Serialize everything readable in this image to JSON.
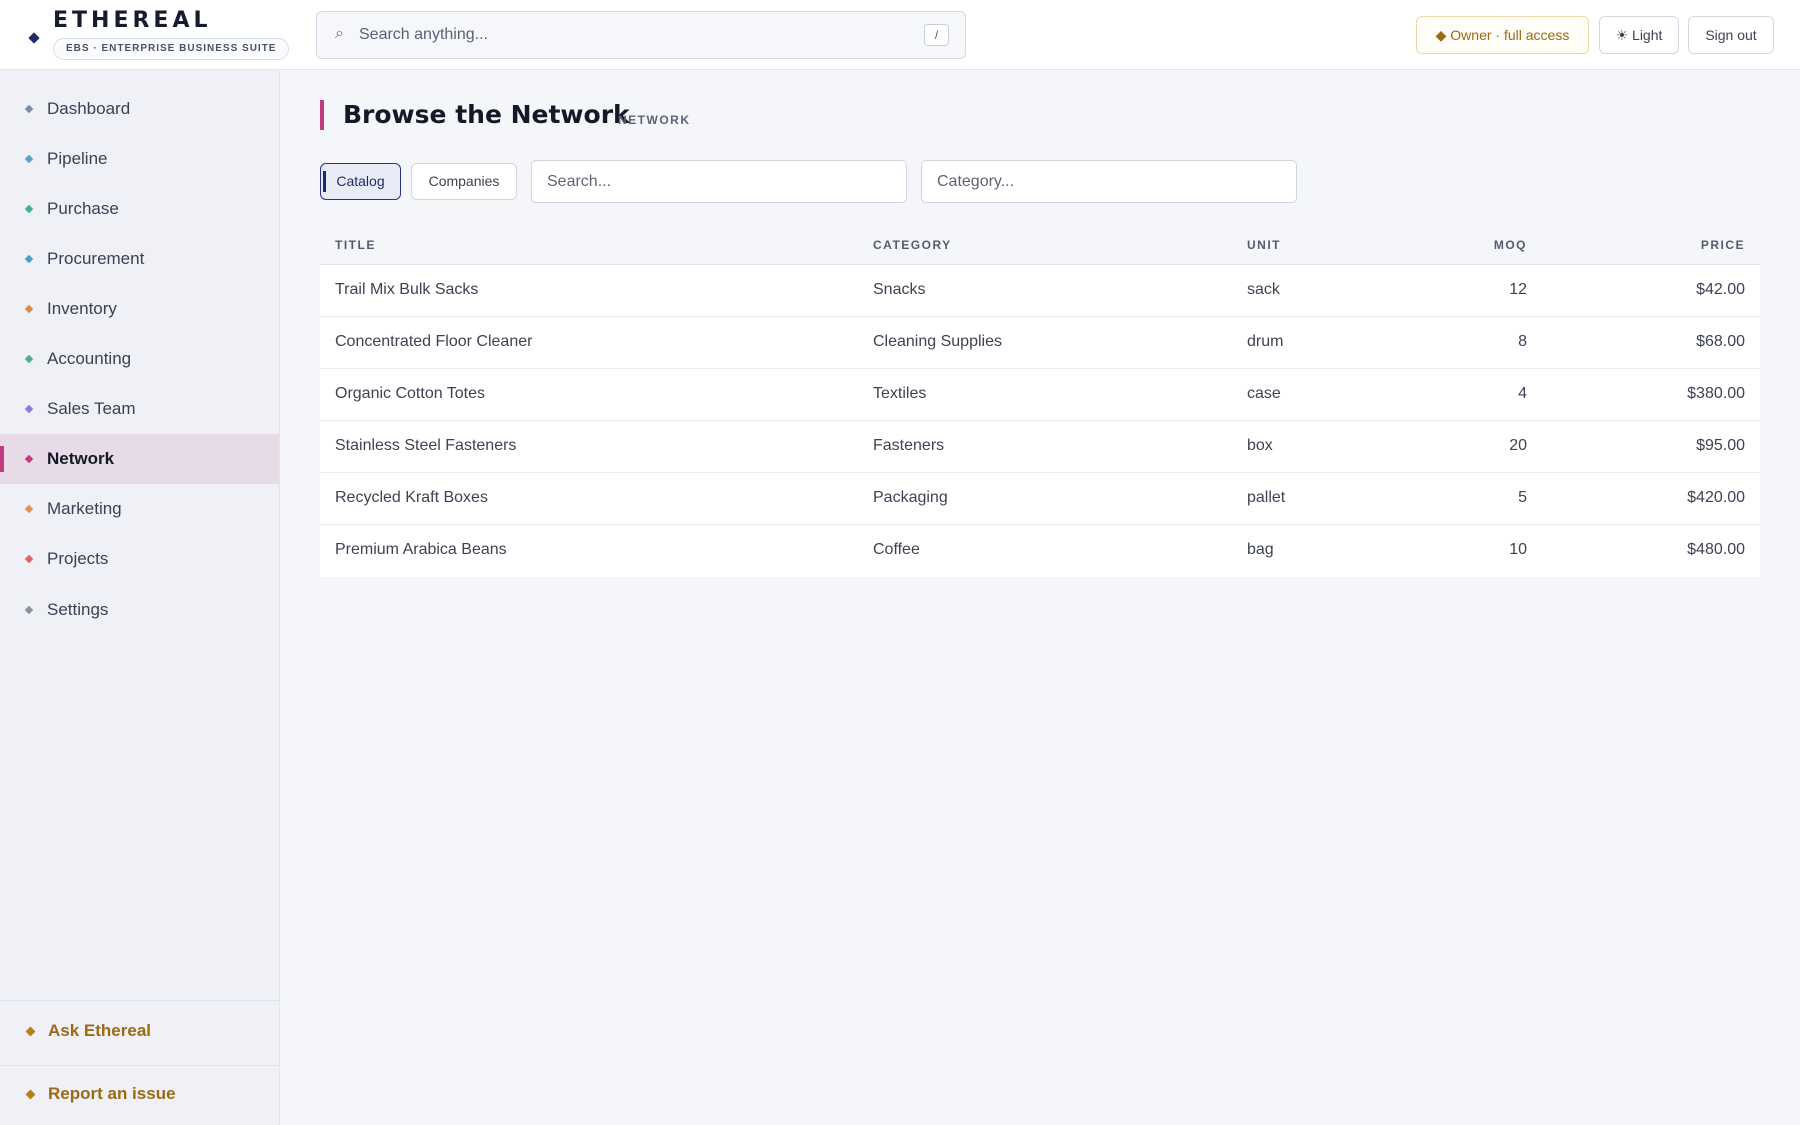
{
  "brand": {
    "name": "ETHEREAL",
    "tagline": "EBS · ENTERPRISE BUSINESS SUITE"
  },
  "search": {
    "placeholder": "Search anything...",
    "shortcut": "/"
  },
  "header_actions": {
    "owner_label": "◆ Owner · full access",
    "theme_label": "☀ Light",
    "signout_label": "Sign out"
  },
  "sidebar": {
    "items": [
      {
        "label": "Dashboard",
        "color": "#7c8aa8"
      },
      {
        "label": "Pipeline",
        "color": "#5aa0c8"
      },
      {
        "label": "Purchase",
        "color": "#3fae9a"
      },
      {
        "label": "Procurement",
        "color": "#4aa3c0"
      },
      {
        "label": "Inventory",
        "color": "#d98b4a"
      },
      {
        "label": "Accounting",
        "color": "#4db08a"
      },
      {
        "label": "Sales Team",
        "color": "#8f7ad6"
      },
      {
        "label": "Network",
        "color": "#c23a80"
      },
      {
        "label": "Marketing",
        "color": "#e0934d"
      },
      {
        "label": "Projects",
        "color": "#e0606a"
      },
      {
        "label": "Settings",
        "color": "#8a93a6"
      }
    ],
    "active_index": 7,
    "footer": {
      "ask_label": "Ask Ethereal",
      "report_label": "Report an issue"
    }
  },
  "page": {
    "title": "Browse the Network",
    "kicker": "NETWORK",
    "tabs": {
      "catalog": "Catalog",
      "companies": "Companies"
    },
    "filters": {
      "search_placeholder": "Search...",
      "category_placeholder": "Category..."
    }
  },
  "table": {
    "headers": {
      "title": "TITLE",
      "category": "CATEGORY",
      "unit": "UNIT",
      "moq": "MOQ",
      "price": "PRICE"
    },
    "rows": [
      {
        "title": "Trail Mix Bulk Sacks",
        "category": "Snacks",
        "unit": "sack",
        "moq": "12",
        "price": "$42.00"
      },
      {
        "title": "Concentrated Floor Cleaner",
        "category": "Cleaning Supplies",
        "unit": "drum",
        "moq": "8",
        "price": "$68.00"
      },
      {
        "title": "Organic Cotton Totes",
        "category": "Textiles",
        "unit": "case",
        "moq": "4",
        "price": "$380.00"
      },
      {
        "title": "Stainless Steel Fasteners",
        "category": "Fasteners",
        "unit": "box",
        "moq": "20",
        "price": "$95.00"
      },
      {
        "title": "Recycled Kraft Boxes",
        "category": "Packaging",
        "unit": "pallet",
        "moq": "5",
        "price": "$420.00"
      },
      {
        "title": "Premium Arabica Beans",
        "category": "Coffee",
        "unit": "bag",
        "moq": "10",
        "price": "$480.00"
      }
    ]
  },
  "colors": {
    "accent": "#c23a80",
    "brand_navy": "#1f2a66",
    "gold": "#9b6a13"
  }
}
